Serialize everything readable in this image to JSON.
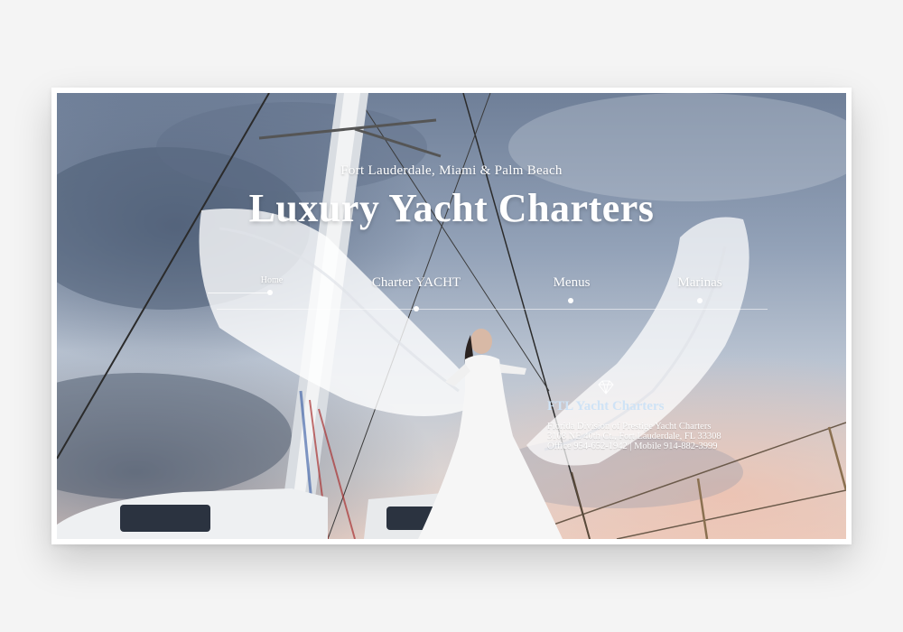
{
  "hero": {
    "tagline": "Fort Lauderdale, Miami & Palm Beach",
    "title": "Luxury Yacht Charters"
  },
  "nav": {
    "items": [
      {
        "label": "Home",
        "active": true
      },
      {
        "label": "Charter YACHT",
        "active": false
      },
      {
        "label": "Menus",
        "active": false
      },
      {
        "label": "Marinas",
        "active": false
      }
    ]
  },
  "contact": {
    "icon": "diamond-icon",
    "company": "FTL Yacht Charters",
    "lines": [
      "Florida Division of Prestige Yacht Charters",
      "3108 NE 40th Ct., Fort Lauderdale, FL 33308",
      "Office 954-652-1942 | Mobile 914-882-3999"
    ]
  },
  "colors": {
    "accent": "#cfe3f6",
    "text": "#ffffff",
    "sky_dark": "#6f7f98",
    "sunset": "#e9d2c8"
  }
}
